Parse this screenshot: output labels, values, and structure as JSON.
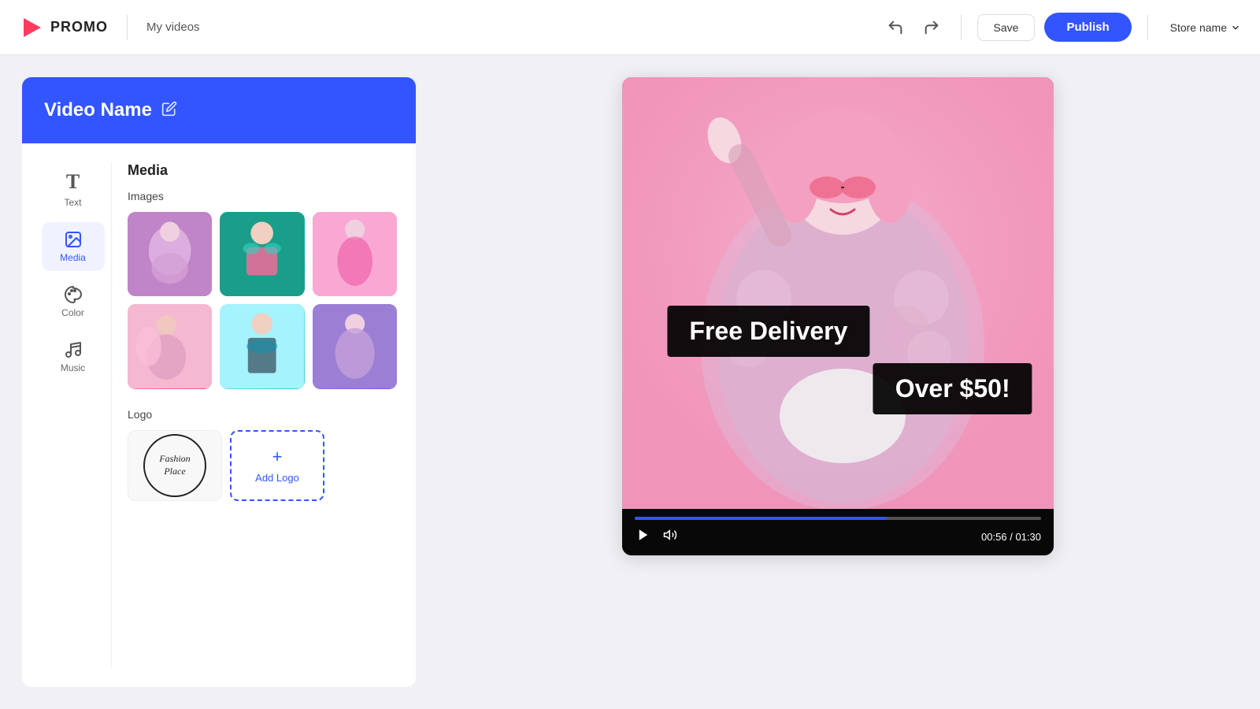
{
  "header": {
    "logo_text": "PROMO",
    "my_videos": "My videos",
    "save_label": "Save",
    "publish_label": "Publish",
    "store_name": "Store name"
  },
  "left_panel": {
    "video_name": "Video Name",
    "sidebar": {
      "items": [
        {
          "id": "text",
          "label": "Text",
          "icon": "T"
        },
        {
          "id": "media",
          "label": "Media",
          "icon": "🖼"
        },
        {
          "id": "color",
          "label": "Color",
          "icon": "🎨"
        },
        {
          "id": "music",
          "label": "Music",
          "icon": "♪"
        }
      ]
    },
    "media_section": {
      "title": "Media",
      "images_label": "Images",
      "logo_label": "Logo",
      "add_logo_label": "Add Logo",
      "fashion_logo_line1": "Fashion",
      "fashion_logo_line2": "Place"
    }
  },
  "video": {
    "overlay_line1": "Free Delivery",
    "overlay_line2": "Over $50!",
    "current_time": "00:56",
    "total_time": "01:30",
    "progress_percent": 62
  },
  "images": [
    {
      "id": 1,
      "bg": "linear-gradient(135deg, #c084c8 0%, #9f559f 100%)"
    },
    {
      "id": 2,
      "bg": "linear-gradient(135deg, #2dd4bf 0%, #0891b2 100%)"
    },
    {
      "id": 3,
      "bg": "linear-gradient(135deg, #f9a8d4 0%, #ec4899 100%)"
    },
    {
      "id": 4,
      "bg": "linear-gradient(135deg, #f9a8d4 0%, #db2777 100%)"
    },
    {
      "id": 5,
      "bg": "linear-gradient(135deg, #67e8f9 0%, #06b6d4 100%)"
    },
    {
      "id": 6,
      "bg": "linear-gradient(135deg, #a78bfa 0%, #7c3aed 100%)"
    }
  ]
}
